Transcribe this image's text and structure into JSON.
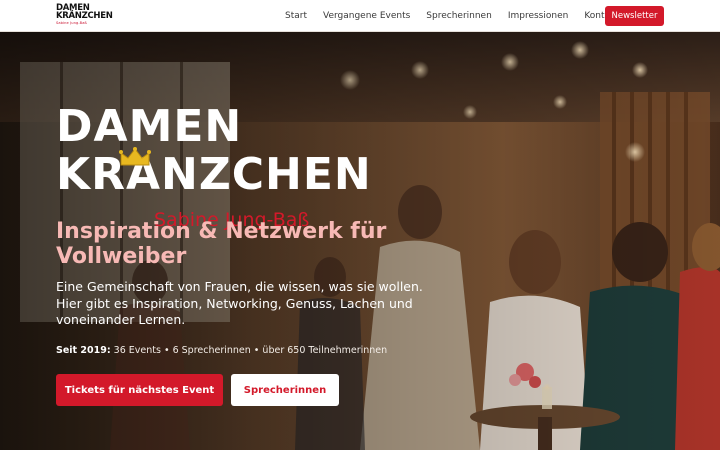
{
  "nav": {
    "logo_line1": "DAMEN",
    "logo_line2": "KRÄNZCHEN",
    "logo_sub": "Sabine Jung-Baß",
    "items": [
      {
        "label": "Start"
      },
      {
        "label": "Vergangene Events"
      },
      {
        "label": "Sprecherinnen"
      },
      {
        "label": "Impressionen"
      },
      {
        "label": "Kontakt"
      }
    ],
    "cta_label": "Newsletter"
  },
  "hero": {
    "logo_line1": "DAMEN",
    "logo_line2": "KRANZCHEN",
    "logo_sub": "Sabine Jung-Baß",
    "headline": "Inspiration & Netzwerk für Vollweiber",
    "lead": "Eine Gemeinschaft von Frauen, die wissen, was sie wollen. Hier gibt es Inspiration, Networking, Genuss, Lachen und voneinander Lernen.",
    "stats_label": "Seit 2019:",
    "stats_text": " 36 Events • 6 Sprecherinnen • über 650 Teilnehmerinnen",
    "primary_button": "Tickets für nächstes Event",
    "secondary_button": "Sprecherinnen",
    "crown_icon": "crown-icon"
  },
  "colors": {
    "accent": "#d3192a",
    "headline": "#f7b9b5",
    "crown": "#e8b820"
  }
}
